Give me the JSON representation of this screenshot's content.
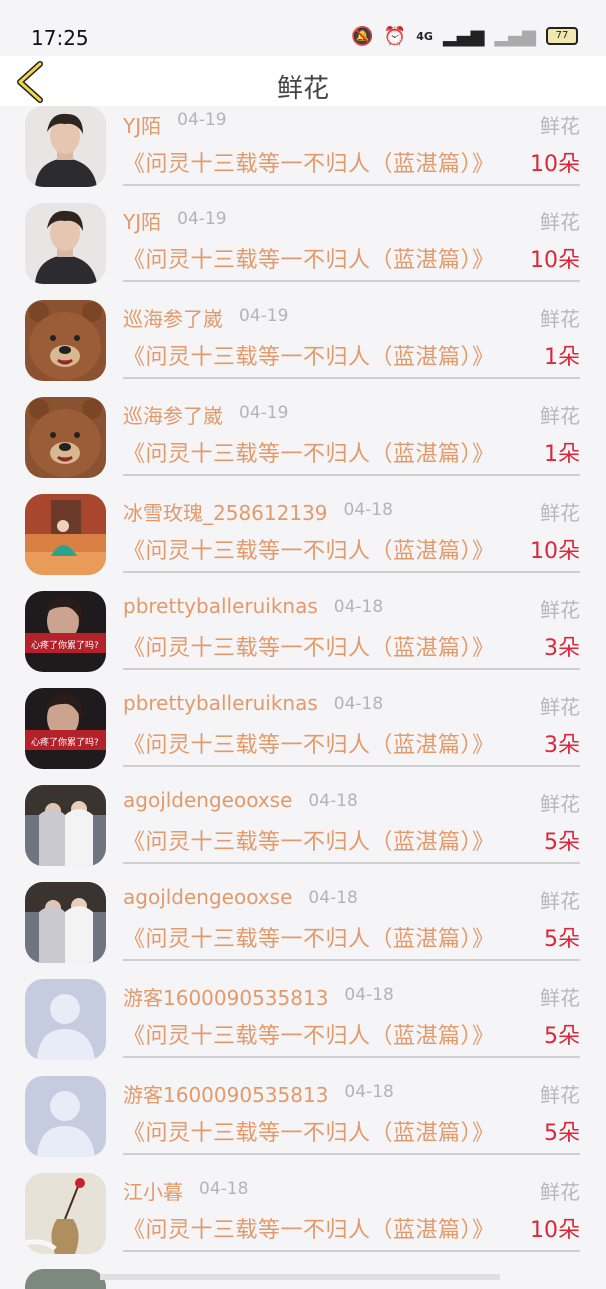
{
  "status_bar": {
    "time": "17:25",
    "network": "4G",
    "battery": "77"
  },
  "header": {
    "title": "鲜花"
  },
  "rows": [
    {
      "name": "YJ陌",
      "date": "04-19",
      "kind": "鲜花",
      "book": "《问灵十三载等一不归人（蓝湛篇）》",
      "count": "10朵",
      "avatar": "portrait-man"
    },
    {
      "name": "YJ陌",
      "date": "04-19",
      "kind": "鲜花",
      "book": "《问灵十三载等一不归人（蓝湛篇）》",
      "count": "10朵",
      "avatar": "portrait-man"
    },
    {
      "name": "巡海参了崴",
      "date": "04-19",
      "kind": "鲜花",
      "book": "《问灵十三载等一不归人（蓝湛篇）》",
      "count": "1朵",
      "avatar": "bear"
    },
    {
      "name": "巡海参了崴",
      "date": "04-19",
      "kind": "鲜花",
      "book": "《问灵十三载等一不归人（蓝湛篇）》",
      "count": "1朵",
      "avatar": "bear"
    },
    {
      "name": "冰雪玫瑰_258612139",
      "date": "04-18",
      "kind": "鲜花",
      "book": "《问灵十三载等一不归人（蓝湛篇）》",
      "count": "10朵",
      "avatar": "girl-orange"
    },
    {
      "name": "pbrettyballeruiknas",
      "date": "04-18",
      "kind": "鲜花",
      "book": "《问灵十三载等一不归人（蓝湛篇）》",
      "count": "3朵",
      "avatar": "dark-red"
    },
    {
      "name": "pbrettyballeruiknas",
      "date": "04-18",
      "kind": "鲜花",
      "book": "《问灵十三载等一不归人（蓝湛篇）》",
      "count": "3朵",
      "avatar": "dark-red"
    },
    {
      "name": "agojldengeooxse",
      "date": "04-18",
      "kind": "鲜花",
      "book": "《问灵十三载等一不归人（蓝湛篇）》",
      "count": "5朵",
      "avatar": "couple"
    },
    {
      "name": "agojldengeooxse",
      "date": "04-18",
      "kind": "鲜花",
      "book": "《问灵十三载等一不归人（蓝湛篇）》",
      "count": "5朵",
      "avatar": "couple"
    },
    {
      "name": "游客1600090535813",
      "date": "04-18",
      "kind": "鲜花",
      "book": "《问灵十三载等一不归人（蓝湛篇）》",
      "count": "5朵",
      "avatar": "default"
    },
    {
      "name": "游客1600090535813",
      "date": "04-18",
      "kind": "鲜花",
      "book": "《问灵十三载等一不归人（蓝湛篇）》",
      "count": "5朵",
      "avatar": "default"
    },
    {
      "name": "江小暮",
      "date": "04-18",
      "kind": "鲜花",
      "book": "《问灵十三载等一不归人（蓝湛篇）》",
      "count": "10朵",
      "avatar": "vase"
    }
  ]
}
